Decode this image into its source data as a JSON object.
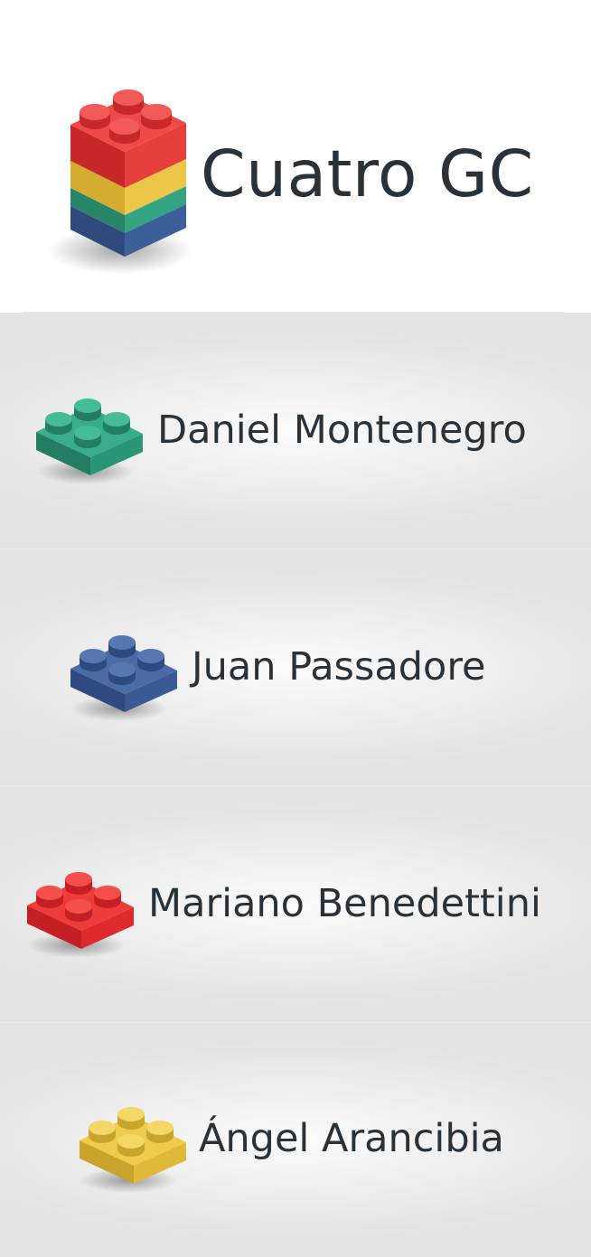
{
  "header": {
    "title": "Cuatro GC",
    "logo_icon": "stacked-brick-icon",
    "stripe_colors": [
      "#e23634",
      "#e6be3c",
      "#2f9a7a",
      "#3a5a92"
    ]
  },
  "members": [
    {
      "name": "Daniel Montenegro",
      "icon": "green-brick-icon",
      "color": "#2fa27f"
    },
    {
      "name": "Juan Passadore",
      "icon": "blue-brick-icon",
      "color": "#3f5f96"
    },
    {
      "name": "Mariano Benedettini",
      "icon": "red-brick-icon",
      "color": "#e52a2d"
    },
    {
      "name": "Ángel Arancibia",
      "icon": "yellow-brick-icon",
      "color": "#e5c23c"
    }
  ]
}
